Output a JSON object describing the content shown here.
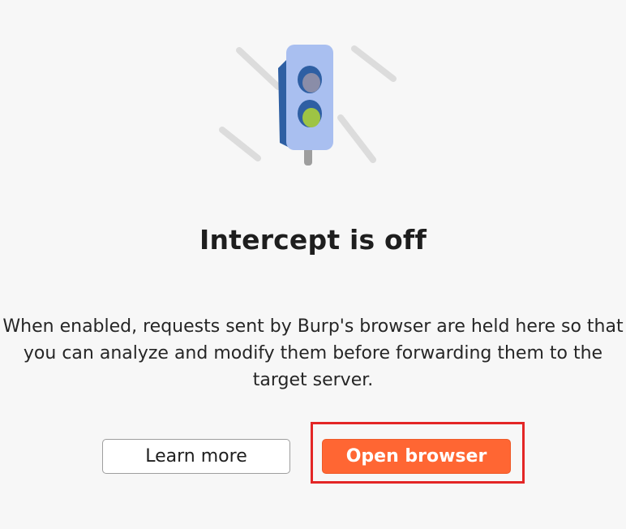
{
  "empty_state": {
    "icon": "traffic-light-icon",
    "title": "Intercept is off",
    "description": "When enabled, requests sent by Burp's browser are held here so that you can analyze and modify them before forwarding them to the target server."
  },
  "buttons": {
    "learn_more": "Learn more",
    "open_browser": "Open browser"
  },
  "colors": {
    "primary_button": "#ff6633",
    "highlight_box": "#e32626",
    "light_body": "#a9bff0",
    "light_side": "#2e5fa3",
    "green_lamp": "#9ec444"
  }
}
